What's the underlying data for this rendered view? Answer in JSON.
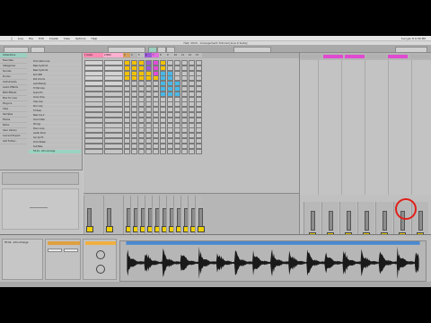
{
  "menu": {
    "items": [
      "Live",
      "File",
      "Edit",
      "Create",
      "View",
      "Options",
      "Help"
    ],
    "clock": "Sun Jan 8 9:39 PM"
  },
  "window": {
    "title": "Hell, 2015 - Arrangement Tutorial [Live 9 Suite]"
  },
  "browser": {
    "categories": [
      "Collections",
      "Favorites",
      "Categories",
      "Sounds",
      "Drums",
      "Instruments",
      "Audio Effects",
      "MIDI Effects",
      "Max for Live",
      "Plug-ins",
      "Clips",
      "Samples",
      "Places",
      "Packs",
      "User Library",
      "Current Project",
      "Add Folder..."
    ],
    "selected_category": 0,
    "files": [
      "Drum Rack loop",
      "Bass Synth 01",
      "Bass Synth 02",
      "Kick 808",
      "Pad Chords",
      "Lead Melody",
      "Hi Hat loop",
      "Snare Fill",
      "Vocal Chop",
      "Clap loop",
      "Perc loop",
      "FX Riser",
      "Bass line 2",
      "Chord Stab",
      "Strings",
      "Piano Loop",
      "Guitar Pluck",
      "Arp Synth",
      "Drum Break",
      "Sub Bass",
      "Fill 04 - Intro Arrange"
    ],
    "selected_file": 20
  },
  "session": {
    "tracks": [
      {
        "name": "1 Audio",
        "color": "#ff8ab3"
      },
      {
        "name": "2 MIDI",
        "color": "#ffb0d0"
      },
      {
        "name": "3",
        "color": "#d6a060"
      },
      {
        "name": "4",
        "color": "#b6b6b6"
      },
      {
        "name": "5",
        "color": "#c0c0c0"
      },
      {
        "name": "6",
        "color": "#9b5ad8"
      },
      {
        "name": "7",
        "color": "#e070e0"
      },
      {
        "name": "8",
        "color": "#bdbdbd"
      },
      {
        "name": "9",
        "color": "#bdbdbd"
      },
      {
        "name": "10",
        "color": "#bdbdbd"
      },
      {
        "name": "11",
        "color": "#bdbdbd"
      },
      {
        "name": "12",
        "color": "#bdbdbd"
      },
      {
        "name": "13",
        "color": "#bdbdbd"
      }
    ],
    "clip_colors": {
      "yellow": "#f2c200",
      "cyan": "#49b8e6",
      "magenta": "#e14ad8",
      "purple": "#9b5ad8",
      "empty": "#c6c6c6"
    }
  },
  "arrange": {
    "header_colors": [
      "#b0b0b0",
      "#e04ad0",
      "#e04ad0",
      "#b0b0b0",
      "#e04ad0",
      "#b0b0b0"
    ],
    "strip_volumes": [
      "0",
      "0",
      "0",
      "0",
      "0",
      "0",
      "0"
    ]
  },
  "detail": {
    "clip_name": "Fill 04 - Intro Arrange",
    "sample_rate": "44.1 kHz",
    "wave_color": "#1a1a1a"
  }
}
